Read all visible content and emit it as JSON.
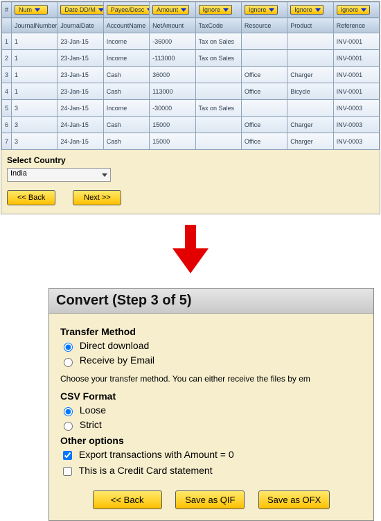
{
  "table": {
    "dropdowns": [
      "Num",
      "Date DD/M",
      "Payee/Desc",
      "Amount",
      "Ignore",
      "Ignore",
      "Ignore",
      "Ignore"
    ],
    "headers": [
      "#",
      "JournalNumber",
      "JournalDate",
      "AccountName",
      "NetAmount",
      "TaxCode",
      "Resource",
      "Product",
      "Reference"
    ],
    "rows": [
      {
        "n": "1",
        "jn": "1",
        "jd": "23-Jan-15",
        "an": "Income",
        "na": "-36000",
        "tc": "Tax on Sales",
        "res": "",
        "prod": "",
        "ref": "INV-0001"
      },
      {
        "n": "2",
        "jn": "1",
        "jd": "23-Jan-15",
        "an": "Income",
        "na": "-113000",
        "tc": "Tax on Sales",
        "res": "",
        "prod": "",
        "ref": "INV-0001"
      },
      {
        "n": "3",
        "jn": "1",
        "jd": "23-Jan-15",
        "an": "Cash",
        "na": "36000",
        "tc": "",
        "res": "Office",
        "prod": "Charger",
        "ref": "INV-0001"
      },
      {
        "n": "4",
        "jn": "1",
        "jd": "23-Jan-15",
        "an": "Cash",
        "na": "113000",
        "tc": "",
        "res": "Office",
        "prod": "Bicycle",
        "ref": "INV-0001"
      },
      {
        "n": "5",
        "jn": "3",
        "jd": "24-Jan-15",
        "an": "Income",
        "na": "-30000",
        "tc": "Tax on Sales",
        "res": "",
        "prod": "",
        "ref": "INV-0003"
      },
      {
        "n": "6",
        "jn": "3",
        "jd": "24-Jan-15",
        "an": "Cash",
        "na": "15000",
        "tc": "",
        "res": "Office",
        "prod": "Charger",
        "ref": "INV-0003"
      },
      {
        "n": "7",
        "jn": "3",
        "jd": "24-Jan-15",
        "an": "Cash",
        "na": "15000",
        "tc": "",
        "res": "Office",
        "prod": "Charger",
        "ref": "INV-0003"
      }
    ]
  },
  "country": {
    "label": "Select Country",
    "value": "India"
  },
  "nav": {
    "back": "<< Back",
    "next": "Next >>"
  },
  "step3": {
    "title": "Convert (Step 3 of 5)",
    "transfer_h": "Transfer Method",
    "opt_direct": "Direct download",
    "opt_email": "Receive by Email",
    "desc": "Choose your transfer method. You can either receive the files by em",
    "csv_h": "CSV Format",
    "opt_loose": "Loose",
    "opt_strict": "Strict",
    "other_h": "Other options",
    "chk_zero": "Export transactions with Amount = 0",
    "chk_cc": "This is a Credit Card statement",
    "btn_back": "<< Back",
    "btn_qif": "Save as QIF",
    "btn_ofx": "Save as OFX"
  }
}
